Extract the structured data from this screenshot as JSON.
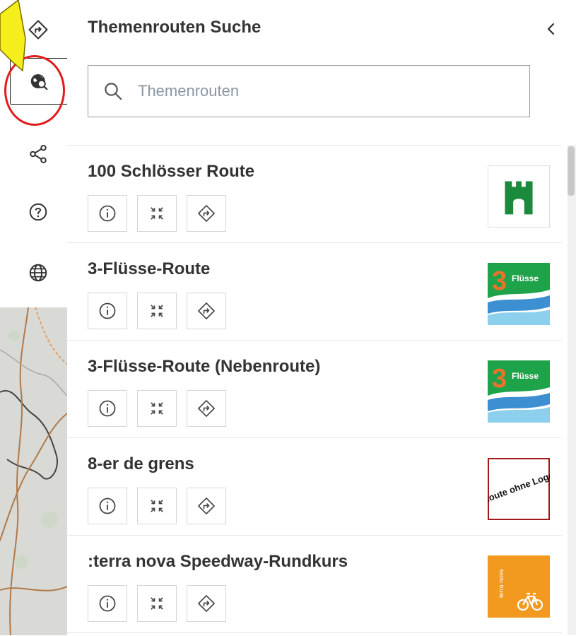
{
  "panel": {
    "title": "Themenrouten Suche",
    "collapse_icon": "chevron-left-icon"
  },
  "search": {
    "placeholder": "Themenrouten",
    "value": "",
    "icon": "search-icon"
  },
  "rail": {
    "items": [
      {
        "icon": "directions-icon"
      },
      {
        "icon": "globe-search-icon",
        "active": true
      },
      {
        "icon": "share-icon"
      },
      {
        "icon": "help-icon"
      },
      {
        "icon": "language-globe-icon"
      }
    ]
  },
  "routes": [
    {
      "title": "100 Schlösser Route",
      "logo": "castle-logo"
    },
    {
      "title": "3-Flüsse-Route",
      "logo": "3-fluesse-logo",
      "logo_text": "Flüsse",
      "logo_number": "3"
    },
    {
      "title": "3-Flüsse-Route (Nebenroute)",
      "logo": "3-fluesse-logo",
      "logo_text": "Flüsse",
      "logo_number": "3"
    },
    {
      "title": "8-er de grens",
      "logo": "route-ohne-logo",
      "logo_text": "Route ohne Logo"
    },
    {
      "title": ":terra nova Speedway-Rundkurs",
      "logo": "terra-nova-logo",
      "logo_text": "terra nova"
    }
  ],
  "colors": {
    "annotation_red": "#e21b1b",
    "annotation_yellow": "#f5ee1a",
    "castle_green": "#1b8a3c",
    "terra_orange": "#f29a1f",
    "fluesse_orange": "#e8742a"
  }
}
